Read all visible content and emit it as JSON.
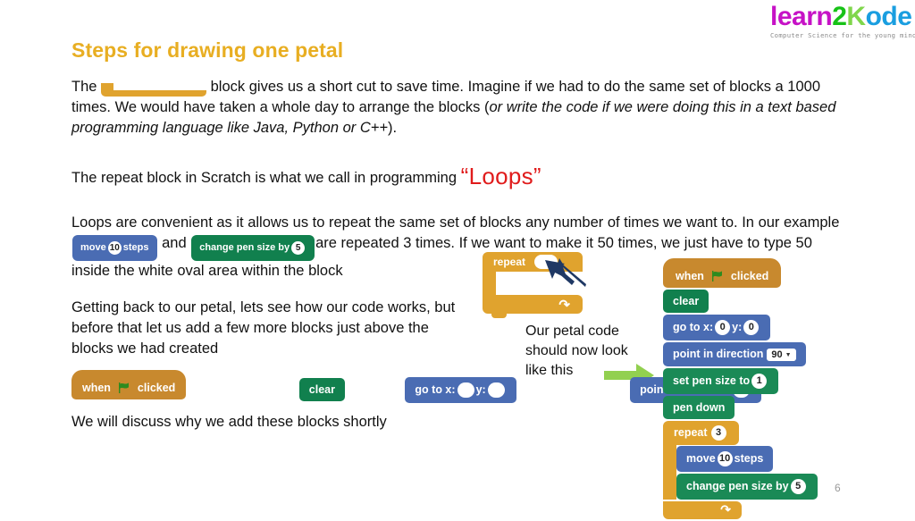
{
  "logo": {
    "part_learn": "learn",
    "part_two": "2",
    "part_k": "K",
    "part_ode": "ode",
    "tagline": "Computer Science for the young minds",
    "colors": {
      "learn": "#c612c6",
      "two": "#17c217",
      "k": "#7fd64b",
      "ode": "#1a9ee0",
      "tagline": "#8a8a8a"
    }
  },
  "title": {
    "text": "Steps for drawing one petal",
    "color": "#e8ae22"
  },
  "paragraphs": {
    "p1_a": "The",
    "p1_b": "block gives us a short cut to save time. Imagine if we had to do the same set of blocks a 1000 times. We would have taken a whole day to arrange the blocks (",
    "p1_italic": "or write the code if we were doing this in a text based programming language like Java, Python or C++",
    "p1_c": ").",
    "p2_a": "The repeat block in Scratch is what we call in programming",
    "p2_loops": "“Loops”",
    "p3_a": "Loops are convenient as it allows us to repeat the same set of blocks any number of times we want to. In our example",
    "p3_b": "and",
    "p3_c": "are repeated 3 times. If we want to make it 50 times, we just have to type 50 inside the white oval area within the block",
    "p4": "Getting back to our petal, lets see how our code works, but before that let us add a few more blocks just above the blocks we had created",
    "p5": "We will discuss why we add these blocks shortly",
    "callout": "Our petal code should now look like this"
  },
  "blocks": {
    "repeat_label": "repeat",
    "repeat_inline_value": "",
    "repeat_big_value": "",
    "move_label_a": "move",
    "move_value": "10",
    "move_label_b": "steps",
    "change_pen_label": "change pen size by",
    "change_pen_value": "5",
    "when_label": "when",
    "clicked_label": "clicked",
    "clear_label": "clear",
    "goto_label_x": "go to x:",
    "goto_value_x": "",
    "goto_label_y": "y:",
    "goto_value_y": "",
    "point_label": "point in direction",
    "point_value": ""
  },
  "script": {
    "when_label": "when",
    "clicked_label": "clicked",
    "clear_label": "clear",
    "goto_label_x": "go to x:",
    "goto_value_x": "0",
    "goto_label_y": "y:",
    "goto_value_y": "0",
    "point_label": "point in direction",
    "point_value": "90",
    "setpen_label": "set pen size to",
    "setpen_value": "1",
    "pendown_label": "pen down",
    "repeat_label": "repeat",
    "repeat_value": "3",
    "move_label_a": "move",
    "move_value": "10",
    "move_label_b": "steps",
    "changepen_label": "change pen size by",
    "changepen_value": "5"
  },
  "colors": {
    "motion_blue": "#4a6cb3",
    "pen_green": "#11804e",
    "control_orange": "#e0a32e",
    "events_brown": "#c8892e",
    "loops_red": "#e01b1b",
    "green_arrow": "#92d050",
    "navy_arrow": "#1f3864"
  },
  "page_number": "6"
}
